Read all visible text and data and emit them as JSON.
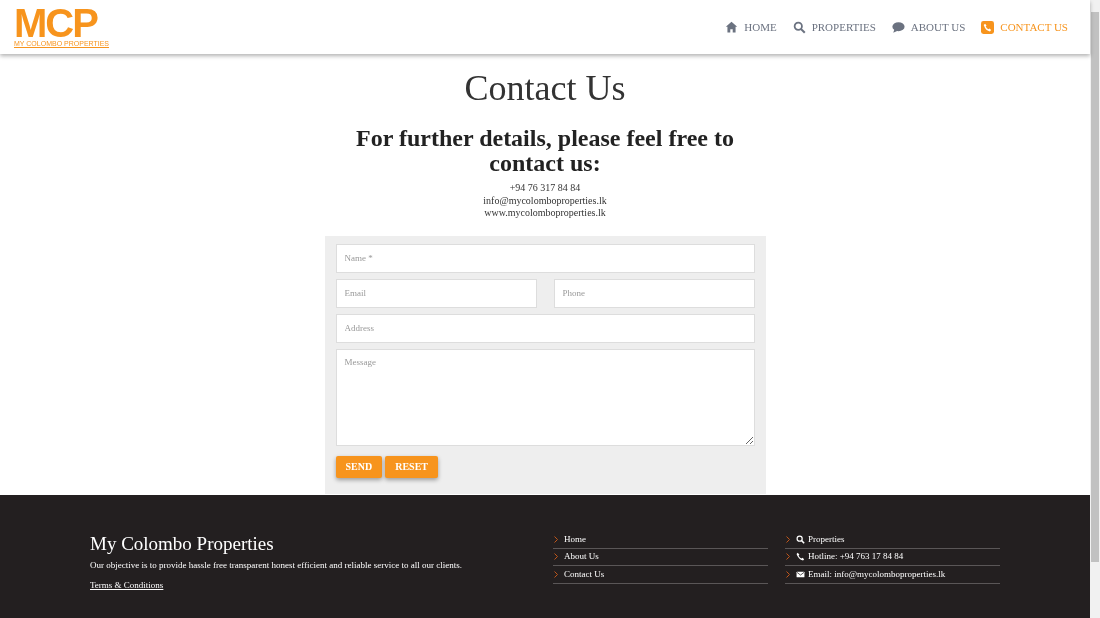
{
  "logo": {
    "mark": "MCP",
    "tagline": "MY COLOMBO PROPERTIES"
  },
  "nav": [
    {
      "label": "HOME",
      "kind": "home",
      "selected": false
    },
    {
      "label": "PROPERTIES",
      "kind": "search",
      "selected": false
    },
    {
      "label": "ABOUT US",
      "kind": "chat",
      "selected": false
    },
    {
      "label": "CONTACT US",
      "kind": "phone",
      "selected": true
    }
  ],
  "page_title": "Contact Us",
  "subheading": "For further details, please feel free to contact us:",
  "contact_lines": [
    "+94 76 317 84 84",
    "info@mycolomboproperties.lk",
    "www.mycolomboproperties.lk"
  ],
  "form": {
    "name": {
      "placeholder": "Name *"
    },
    "email": {
      "placeholder": "Email"
    },
    "phone": {
      "placeholder": "Phone"
    },
    "address": {
      "placeholder": "Address"
    },
    "message": {
      "placeholder": "Message"
    },
    "buttons": [
      "SEND",
      "RESET"
    ]
  },
  "footer": {
    "title": "My Colombo Properties",
    "description": "Our objective is to provide hassle free transparent honest efficient and reliable service to all our clients.",
    "terms_link": "Terms & Conditions",
    "links": [
      {
        "label": "Home"
      },
      {
        "label": "About Us"
      },
      {
        "label": "Contact Us"
      }
    ],
    "contacts": [
      {
        "label": "Properties",
        "kind": "search"
      },
      {
        "label": "Hotline: +94 763 17 84 84",
        "kind": "phone"
      },
      {
        "label": "Email: info@mycolomboproperties.lk",
        "kind": "mail"
      }
    ]
  }
}
